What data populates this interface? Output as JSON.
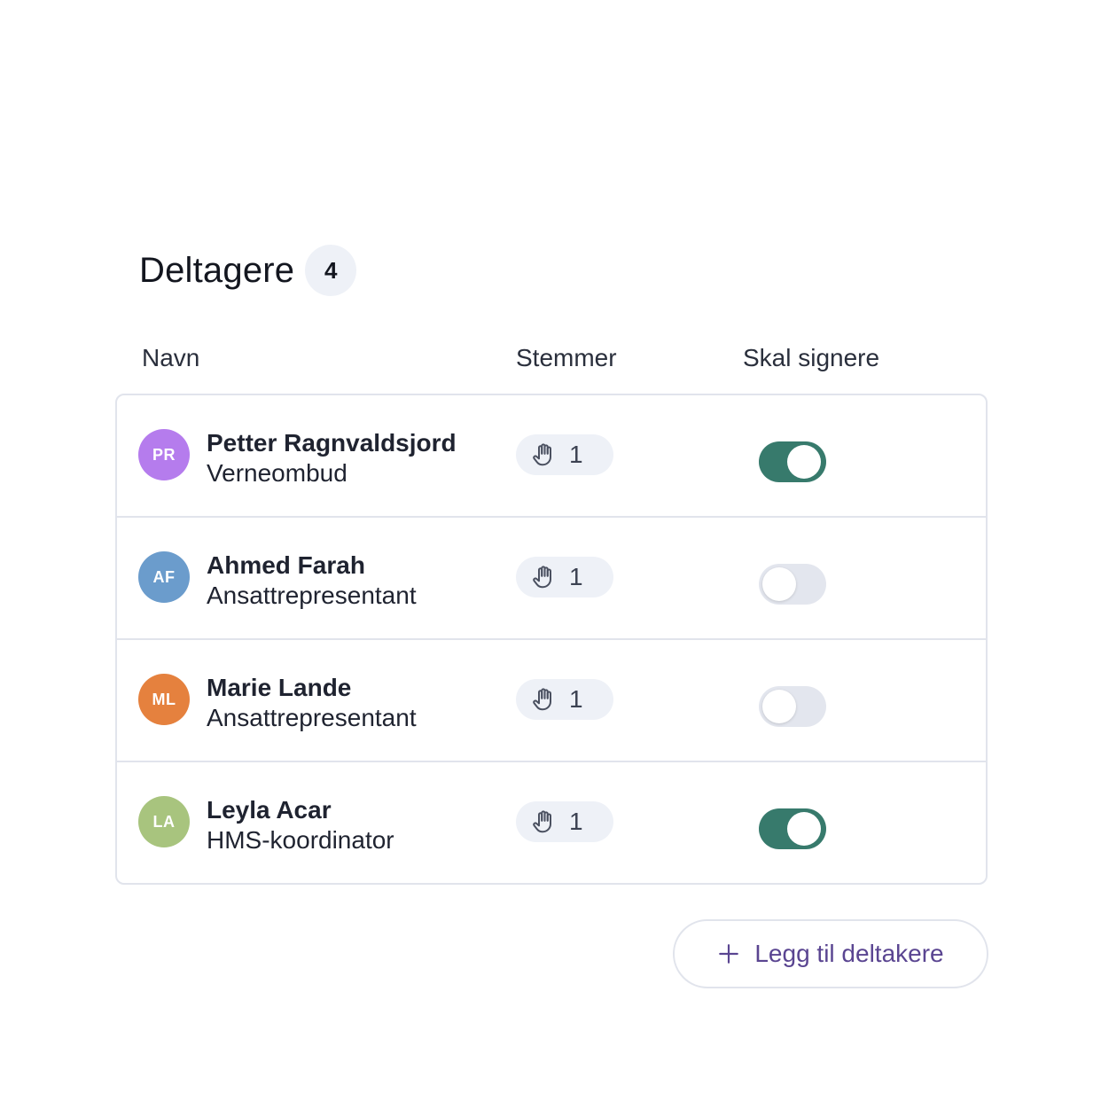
{
  "section": {
    "title": "Deltagere",
    "count": "4"
  },
  "columns": {
    "name": "Navn",
    "votes": "Stemmer",
    "sign": "Skal signere"
  },
  "participants": [
    {
      "initials": "PR",
      "name": "Petter Ragnvaldsjord",
      "role": "Verneombud",
      "votes": "1",
      "must_sign": true,
      "avatar_color": "#b57ced"
    },
    {
      "initials": "AF",
      "name": "Ahmed Farah",
      "role": "Ansattrepresentant",
      "votes": "1",
      "must_sign": false,
      "avatar_color": "#6b9ccc"
    },
    {
      "initials": "ML",
      "name": "Marie Lande",
      "role": "Ansattrepresentant",
      "votes": "1",
      "must_sign": false,
      "avatar_color": "#e5813e"
    },
    {
      "initials": "LA",
      "name": "Leyla Acar",
      "role": "HMS-koordinator",
      "votes": "1",
      "must_sign": true,
      "avatar_color": "#a8c47e"
    }
  ],
  "add_button": {
    "label": "Legg til deltakere",
    "icon": "plus-icon"
  },
  "colors": {
    "toggle_on": "#377a6c",
    "toggle_off": "#e3e6ee",
    "accent_text": "#5a4591"
  }
}
